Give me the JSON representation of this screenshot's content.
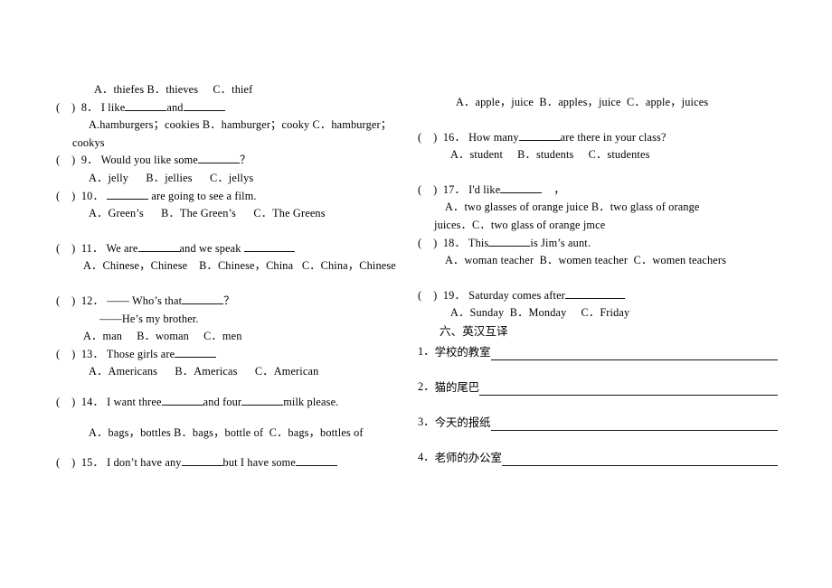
{
  "document": {
    "type": "english-exam-worksheet",
    "marker": "(    )"
  },
  "left_column": {
    "orphan_options": "A．thiefes B．thieves     C．thief",
    "questions": [
      {
        "number": "8．",
        "stem_pre": "I like",
        "stem_mid": "and",
        "stem_post": "",
        "options_line1": "A.hamburgers；cookies B．hamburger；cooky C．hamburger；",
        "options_line2": "cookys"
      },
      {
        "number": "9．",
        "stem_pre": "Would you like some",
        "stem_post": "？",
        "options_line1": "A．jelly      B．jellies      C．jellys"
      },
      {
        "number": "10．",
        "stem_pre": "",
        "stem_post": "are going to see a film.",
        "options_line1": "A．Green’s      B．The Green’s      C．The Greens"
      },
      {
        "number": "11．",
        "stem_pre": "We are",
        "stem_mid": "and we speak",
        "stem_post": "",
        "options_line1": "A．Chinese，Chinese    B．Chinese，China   C．China，Chinese"
      },
      {
        "number": "12．",
        "stem_pre": "—— Who’s that",
        "stem_post": "？",
        "stem_line2": "——He’s my brother.",
        "options_line1": "A．man     B．woman     C．men"
      },
      {
        "number": "13．",
        "stem_pre": "Those girls are",
        "stem_post": "",
        "options_line1": "A．Americans      B．Americas      C．American"
      },
      {
        "number": "14．",
        "stem_pre": "I want three",
        "stem_mid": "and four",
        "stem_post": "milk please.",
        "options_line1": "A．bags，bottles B．bags，bottle of  C．bags，bottles of"
      },
      {
        "number": "15．",
        "stem_pre": "I don’t have any",
        "stem_mid": "but I have some",
        "stem_post": "",
        "options_line1": ""
      }
    ]
  },
  "right_column": {
    "orphan_options": "A．apple，juice  B．apples，juice  C．apple，juices",
    "questions": [
      {
        "number": "16．",
        "stem_pre": "How many",
        "stem_post": "are there in your class?",
        "options_line1": "A．student     B．students     C．studentes"
      },
      {
        "number": "17．",
        "stem_pre": "I'd like",
        "stem_post": "，",
        "options_line1": "A．two glasses of orange juice B．two glass of orange",
        "options_line2": "juices．C．two glass of orange jmce"
      },
      {
        "number": "18．",
        "stem_pre": "This",
        "stem_post": "is Jim’s aunt.",
        "options_line1": "A．woman teacher  B．women teacher  C．women teachers"
      },
      {
        "number": "19．",
        "stem_pre": "Saturday comes after",
        "stem_post": "",
        "options_line1": "A．Sunday  B．Monday     C．Friday"
      }
    ],
    "translation_section": {
      "heading": "六、英汉互译",
      "items": [
        {
          "number": "1．",
          "text": "学校的教室"
        },
        {
          "number": "2．",
          "text": "猫的尾巴"
        },
        {
          "number": "3．",
          "text": "今天的报纸"
        },
        {
          "number": "4．",
          "text": "老师的办公室"
        }
      ]
    }
  }
}
